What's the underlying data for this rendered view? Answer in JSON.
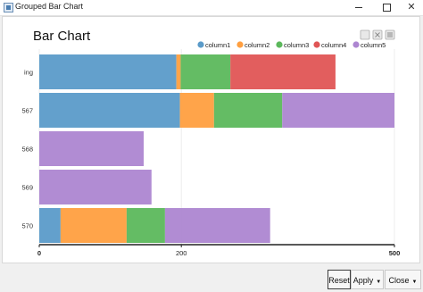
{
  "window": {
    "title": "Grouped Bar Chart"
  },
  "toolbar": {
    "icons": [
      "save-icon",
      "expand-icon",
      "menu-icon"
    ]
  },
  "buttons": {
    "reset": "Reset",
    "apply": "Apply",
    "close": "Close"
  },
  "colors": {
    "column1": "#5b9bc9",
    "column2": "#ff9f40",
    "column3": "#5cb85c",
    "column4": "#e05555",
    "column5": "#ad86d1"
  },
  "chart_data": {
    "type": "bar",
    "orientation": "horizontal",
    "stacked": true,
    "title": "Bar Chart",
    "categories": [
      "ing",
      "567",
      "568",
      "569",
      "570"
    ],
    "series": [
      {
        "name": "column1",
        "values": [
          193,
          198,
          0,
          0,
          30
        ]
      },
      {
        "name": "column2",
        "values": [
          6,
          48,
          0,
          0,
          93
        ]
      },
      {
        "name": "column3",
        "values": [
          70,
          96,
          0,
          0,
          54
        ]
      },
      {
        "name": "column4",
        "values": [
          148,
          0,
          0,
          0,
          0
        ]
      },
      {
        "name": "column5",
        "values": [
          0,
          158,
          147,
          158,
          148
        ]
      }
    ],
    "xlim": [
      0,
      500
    ],
    "xticks": [
      "0",
      "200",
      "500"
    ],
    "grid": true,
    "legend": "top-right"
  }
}
